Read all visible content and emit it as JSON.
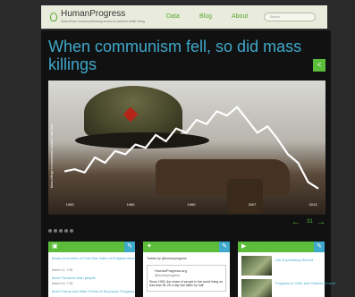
{
  "site": {
    "name": "HumanProgress",
    "tagline": "Data-driven human-well-being scores to achieve better living",
    "nav": [
      "Data",
      "Blog",
      "About"
    ],
    "search_placeholder": "Search"
  },
  "hero": {
    "headline": "When communism fell, so did mass killings",
    "ylabel": "Mass killings in communist countries over time",
    "x_ticks": [
      "1900",
      "1960",
      "1990",
      "2007",
      "2013"
    ],
    "pager_number": "31"
  },
  "chart_data": {
    "type": "line",
    "x": [
      1,
      2,
      3,
      4,
      5,
      6,
      7,
      8,
      9,
      10,
      11,
      12,
      13,
      14,
      15,
      16,
      17,
      18,
      19,
      20,
      21,
      22,
      23,
      24,
      25,
      26
    ],
    "values": [
      22,
      24,
      21,
      35,
      30,
      41,
      38,
      47,
      44,
      56,
      50,
      62,
      58,
      70,
      66,
      78,
      74,
      82,
      70,
      58,
      64,
      52,
      38,
      30,
      12,
      6
    ],
    "ylim": [
      0,
      100
    ]
  },
  "cards": [
    {
      "icon": "blog-icon",
      "lines": [
        "Books lend hints of Cold War Index of Enlightenment",
        "More Pensions than people",
        "More Farms and other Forms of Economic Progress"
      ],
      "meta": [
        "March 11, 7:35",
        "March 10, 7:35"
      ]
    },
    {
      "icon": "twitter-icon",
      "header": "Tweets by @humanprogress",
      "tweet_name": "HumanProgress.org",
      "tweet_handle": "@humanprogress",
      "tweet_text": "Since 1990, the share of people in the world living on less than $1.25 a day has fallen by half"
    },
    {
      "icon": "youtube-icon",
      "videos": [
        "Life Expectancy Record",
        "Progress in Chile and Chilean Growth"
      ]
    }
  ]
}
